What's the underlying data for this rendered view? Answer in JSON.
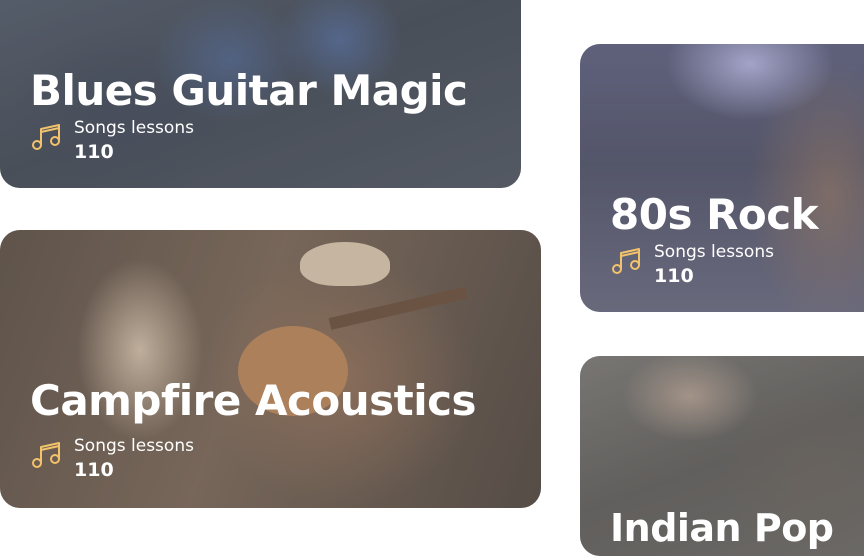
{
  "cards": [
    {
      "title": "Blues Guitar Magic",
      "label": "Songs lessons",
      "count": "110",
      "icon": "music-note-icon"
    },
    {
      "title": "Campfire Acoustics",
      "label": "Songs lessons",
      "count": "110",
      "icon": "music-note-icon"
    },
    {
      "title": "80s Rock",
      "label": "Songs lessons",
      "count": "110",
      "icon": "music-note-icon"
    },
    {
      "title": "Indian Pop"
    }
  ],
  "colors": {
    "icon": "#f2c36b",
    "text": "#ffffff"
  }
}
